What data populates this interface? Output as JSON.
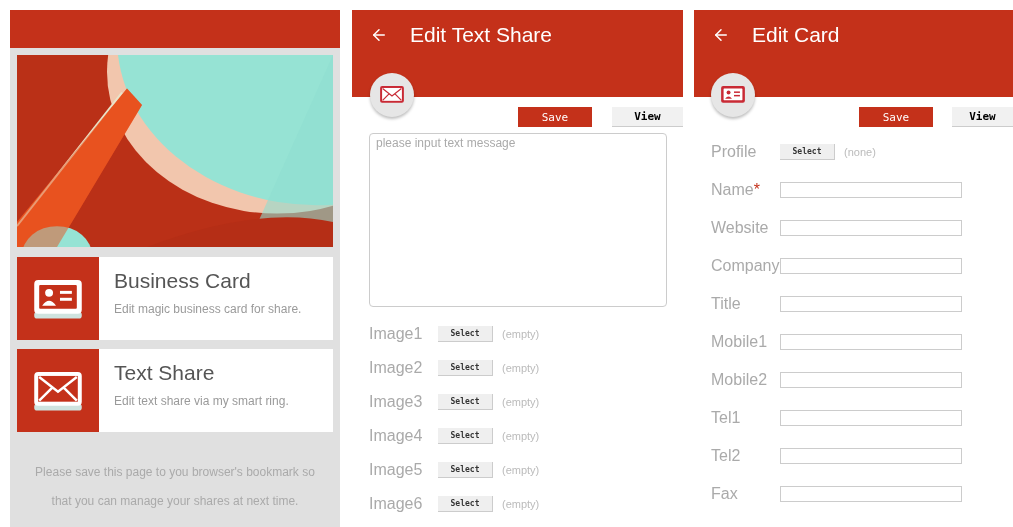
{
  "home": {
    "cards": [
      {
        "kind": "card",
        "title": "Business Card",
        "description": "Edit magic business card for share."
      },
      {
        "kind": "mail",
        "title": "Text Share",
        "description": "Edit text share via my smart ring."
      }
    ],
    "note": "Please save this page to you browser's bookmark so that you can manage your shares at next time."
  },
  "text_share": {
    "title": "Edit Text Share",
    "save": "Save",
    "view": "View",
    "message": {
      "placeholder": "please input text message"
    },
    "images": [
      {
        "label": "Image1",
        "button": "Select",
        "value": "(empty)"
      },
      {
        "label": "Image2",
        "button": "Select",
        "value": "(empty)"
      },
      {
        "label": "Image3",
        "button": "Select",
        "value": "(empty)"
      },
      {
        "label": "Image4",
        "button": "Select",
        "value": "(empty)"
      },
      {
        "label": "Image5",
        "button": "Select",
        "value": "(empty)"
      },
      {
        "label": "Image6",
        "button": "Select",
        "value": "(empty)"
      }
    ]
  },
  "edit_card": {
    "title": "Edit Card",
    "save": "Save",
    "view": "View",
    "profile": {
      "label": "Profile",
      "button": "Select",
      "value": "(none)"
    },
    "fields": [
      {
        "label": "Name",
        "required_mark": "*"
      },
      {
        "label": "Website"
      },
      {
        "label": "Company"
      },
      {
        "label": "Title"
      },
      {
        "label": "Mobile1"
      },
      {
        "label": "Mobile2"
      },
      {
        "label": "Tel1"
      },
      {
        "label": "Tel2"
      },
      {
        "label": "Fax"
      }
    ]
  }
}
